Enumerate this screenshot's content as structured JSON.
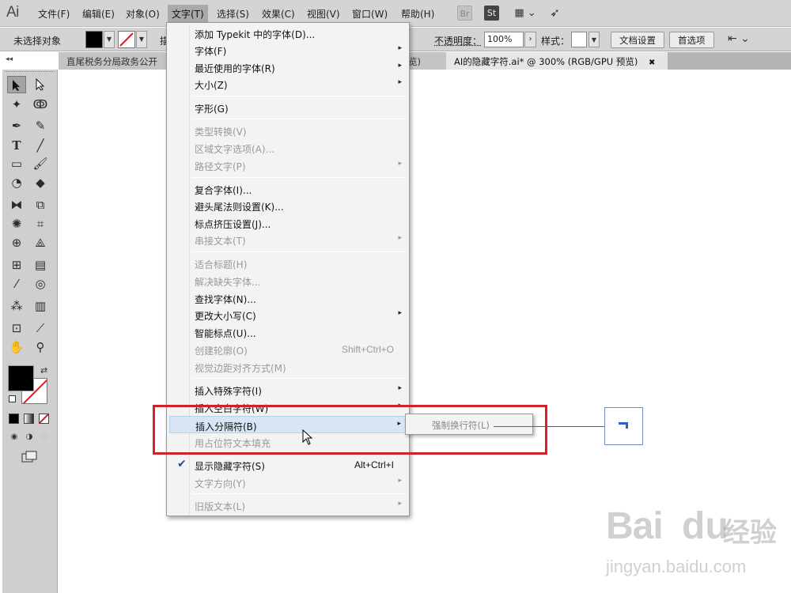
{
  "app": {
    "logo": "Ai"
  },
  "menubar": {
    "items": [
      "文件(F)",
      "编辑(E)",
      "对象(O)",
      "文字(T)",
      "选择(S)",
      "效果(C)",
      "视图(V)",
      "窗口(W)",
      "帮助(H)"
    ],
    "bridge_label": "Br",
    "stock_label": "St"
  },
  "controlbar": {
    "selection_status": "未选择对象",
    "stroke_label_partial": "描",
    "opacity_label": "不透明度：",
    "opacity_value": "100%",
    "style_label": "样式：",
    "doc_setup": "文档设置",
    "preferences": "首选项"
  },
  "tabs": [
    {
      "label": "直尾税务分局政务公开"
    },
    {
      "label": "览)"
    },
    {
      "label": "AI的隐藏字符.ai* @ 300% (RGB/GPU 预览)",
      "close": "✖"
    }
  ],
  "type_menu": {
    "items": [
      {
        "label": "添加 Typekit 中的字体(D)...",
        "enabled": true
      },
      {
        "label": "字体(F)",
        "enabled": true,
        "submenu": true
      },
      {
        "label": "最近使用的字体(R)",
        "enabled": true,
        "submenu": true
      },
      {
        "label": "大小(Z)",
        "enabled": true,
        "submenu": true
      },
      {
        "label": "字形(G)",
        "enabled": true
      },
      {
        "label": "类型转换(V)",
        "enabled": false
      },
      {
        "label": "区域文字选项(A)...",
        "enabled": false
      },
      {
        "label": "路径文字(P)",
        "enabled": false,
        "submenu": true
      },
      {
        "label": "复合字体(I)...",
        "enabled": true
      },
      {
        "label": "避头尾法则设置(K)...",
        "enabled": true
      },
      {
        "label": "标点挤压设置(J)...",
        "enabled": true
      },
      {
        "label": "串接文本(T)",
        "enabled": false,
        "submenu": true
      },
      {
        "label": "适合标题(H)",
        "enabled": false
      },
      {
        "label": "解决缺失字体...",
        "enabled": false
      },
      {
        "label": "查找字体(N)...",
        "enabled": true
      },
      {
        "label": "更改大小写(C)",
        "enabled": true,
        "submenu": true
      },
      {
        "label": "智能标点(U)...",
        "enabled": true
      },
      {
        "label": "创建轮廓(O)",
        "enabled": false,
        "shortcut": "Shift+Ctrl+O"
      },
      {
        "label": "视觉边距对齐方式(M)",
        "enabled": false
      },
      {
        "label": "插入特殊字符(I)",
        "enabled": true,
        "submenu": true
      },
      {
        "label": "插入空白字符(W)",
        "enabled": true,
        "submenu": true
      },
      {
        "label": "插入分隔符(B)",
        "enabled": true,
        "submenu": true,
        "highlighted": true
      },
      {
        "label": "用占位符文本填充",
        "enabled": false
      },
      {
        "label": "显示隐藏字符(S)",
        "enabled": true,
        "checked": true,
        "shortcut": "Alt+Ctrl+I"
      },
      {
        "label": "文字方向(Y)",
        "enabled": false,
        "submenu": true
      },
      {
        "label": "旧版文本(L)",
        "enabled": false,
        "submenu": true
      }
    ]
  },
  "submenu": {
    "label": "强制换行符(L)",
    "enabled": false
  },
  "icons": {
    "submenu_arrow": "▸",
    "check": "✔",
    "menubar_chevron": "⌄"
  },
  "watermark": {
    "main": "Bai",
    "main2": "du",
    "cn": "经验",
    "sub": "jingyan.baidu.com"
  },
  "colors": {
    "highlight": "#d1222a",
    "menu_hover": "#d7e5f5",
    "callout_glyph": "#2f5ec4"
  }
}
